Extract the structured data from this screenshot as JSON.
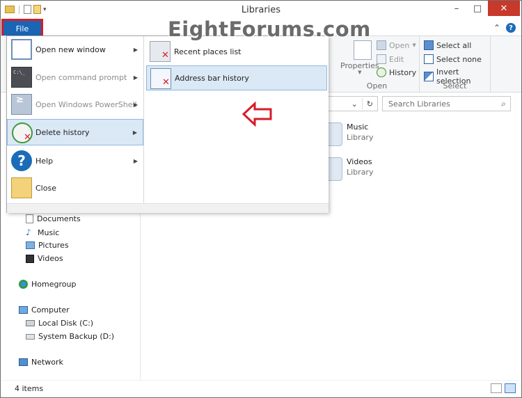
{
  "window": {
    "title": "Libraries"
  },
  "watermark": "EightForums.com",
  "tabs": {
    "file": "File"
  },
  "ribbon": {
    "open_group": {
      "label": "Open",
      "properties": "Properties",
      "open": "Open",
      "edit": "Edit",
      "history": "History"
    },
    "select_group": {
      "label": "Select",
      "select_all": "Select all",
      "select_none": "Select none",
      "invert": "Invert selection"
    }
  },
  "search": {
    "placeholder": "Search Libraries"
  },
  "file_menu": {
    "items": [
      {
        "label": "Open new window"
      },
      {
        "label": "Open command prompt"
      },
      {
        "label": "Open Windows PowerShell"
      },
      {
        "label": "Delete history"
      },
      {
        "label": "Help"
      },
      {
        "label": "Close"
      }
    ],
    "submenu": [
      {
        "label": "Recent places list"
      },
      {
        "label": "Address bar history"
      }
    ]
  },
  "nav": {
    "items": [
      {
        "label": "Documents"
      },
      {
        "label": "Music"
      },
      {
        "label": "Pictures"
      },
      {
        "label": "Videos"
      },
      {
        "label": "Homegroup"
      },
      {
        "label": "Computer"
      },
      {
        "label": "Local Disk (C:)"
      },
      {
        "label": "System Backup (D:)"
      },
      {
        "label": "Network"
      }
    ]
  },
  "content": {
    "libraries": [
      {
        "name": "Music",
        "type": "Library"
      },
      {
        "name": "Videos",
        "type": "Library"
      }
    ]
  },
  "status": {
    "count": "4 items"
  },
  "colors": {
    "accent": "#1a66b5",
    "highlight": "#dbe8f5",
    "annotation_red": "#d81b2a",
    "close_button": "#c7392b"
  }
}
